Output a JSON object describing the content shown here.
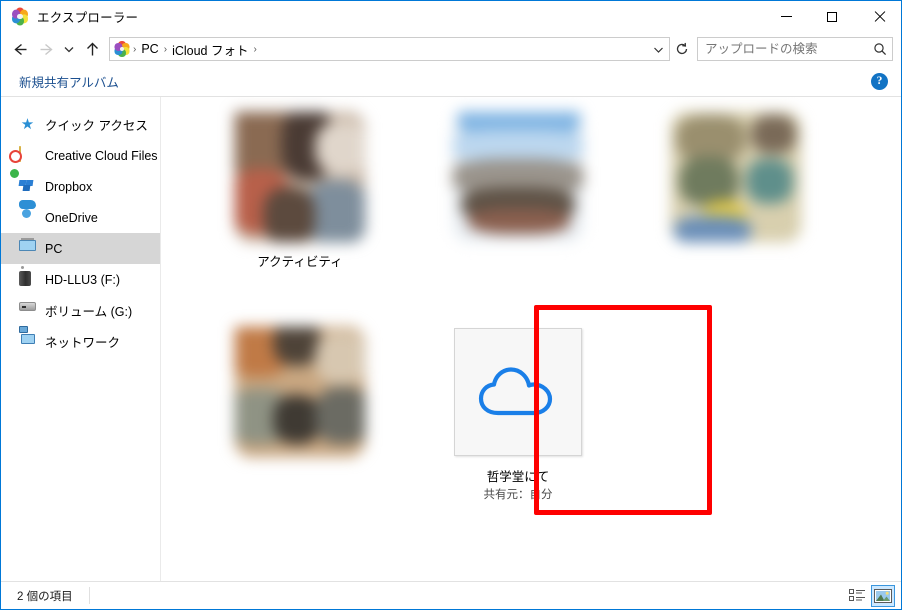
{
  "window": {
    "title": "エクスプローラー",
    "app_icon": "icloud-photos-icon",
    "minimize_label": "—",
    "maximize_label": "□",
    "close_label": "✕"
  },
  "address_bar": {
    "back_label": "←",
    "forward_label": "→",
    "recent_label": "⌄",
    "up_label": "↑",
    "breadcrumb_icon": "icloud-photos-icon",
    "crumbs": [
      "PC",
      "iCloud フォト"
    ],
    "separator": "›",
    "dropdown_label": "⌄",
    "refresh_label": "↻"
  },
  "search": {
    "placeholder": "アップロードの検索",
    "value": "",
    "icon": "search-icon"
  },
  "command_bar": {
    "new_shared_album_label": "新規共有アルバム",
    "help_label": "?"
  },
  "sidebar": {
    "items": [
      {
        "label": "クイック アクセス",
        "icon": "star-icon",
        "selected": false
      },
      {
        "label": "Creative Cloud Files",
        "icon": "creative-cloud-icon",
        "selected": false
      },
      {
        "label": "Dropbox",
        "icon": "dropbox-icon",
        "selected": false
      },
      {
        "label": "OneDrive",
        "icon": "onedrive-icon",
        "selected": false
      },
      {
        "label": "PC",
        "icon": "pc-icon",
        "selected": true
      },
      {
        "label": "HD-LLU3 (F:)",
        "icon": "hard-disk-icon",
        "selected": false
      },
      {
        "label": "ボリューム (G:)",
        "icon": "volume-drive-icon",
        "selected": false
      },
      {
        "label": "ネットワーク",
        "icon": "network-icon",
        "selected": false
      }
    ]
  },
  "content": {
    "tiles": [
      {
        "label": "アクティビティ",
        "sublabel": "",
        "type": "photo",
        "selected": false,
        "colors": [
          "#8a6a52",
          "#4a3b34",
          "#c9b7a6",
          "#e0d6cb",
          "#7e8e9c",
          "#b8604a"
        ]
      },
      {
        "label": "",
        "sublabel": "",
        "type": "photo",
        "selected": false,
        "colors": [
          "#7fb4e3",
          "#bcd7ef",
          "#dcdcd8",
          "#9a948c",
          "#5e5246",
          "#8a5f4e"
        ]
      },
      {
        "label": "",
        "sublabel": "",
        "type": "photo",
        "selected": false,
        "colors": [
          "#9a8f6e",
          "#6f7b5e",
          "#d8cfae",
          "#5f8f8b",
          "#e0c84a",
          "#7a6a58"
        ]
      },
      {
        "label": "",
        "sublabel": "",
        "type": "photo",
        "selected": false,
        "colors": [
          "#c07a46",
          "#4e4338",
          "#8f9384",
          "#d7c7b0",
          "#6b6b63",
          "#3f3a33"
        ]
      },
      {
        "label": "哲学堂にて",
        "sublabel": "共有元：自分",
        "type": "album",
        "selected": true,
        "icon": "cloud-icon"
      }
    ]
  },
  "status_bar": {
    "item_count_label": "2 個の項目",
    "view_details_icon": "details-view-icon",
    "view_large_icons_icon": "large-icons-view-icon",
    "active_view": "large-icons"
  },
  "colors": {
    "accent": "#0078d7",
    "highlight_box": "#fe0000",
    "cloud_blue": "#1a7fe8",
    "link_blue": "#1b4f8f",
    "selection_gray": "#d6d6d6"
  }
}
